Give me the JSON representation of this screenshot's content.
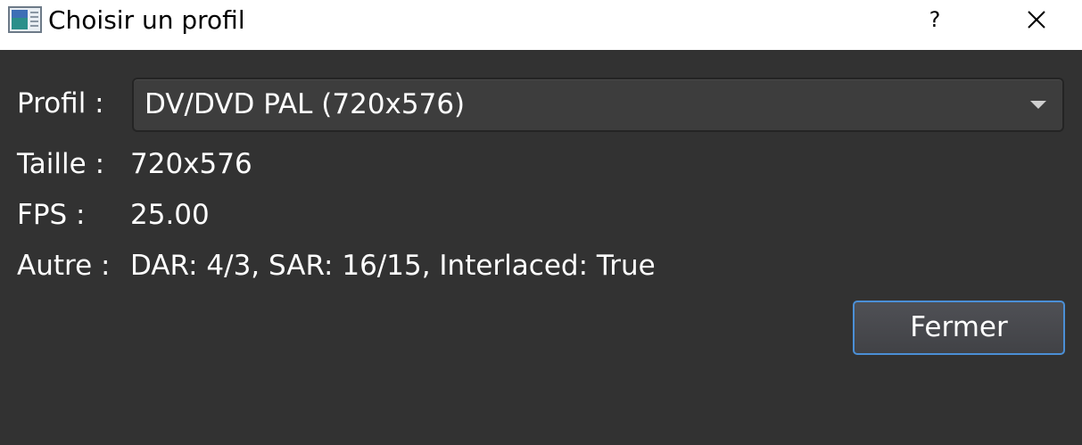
{
  "window": {
    "title": "Choisir un profil",
    "icon": "app-icon",
    "help_label": "?",
    "close_icon": "close-icon"
  },
  "form": {
    "profile_label": "Profil :",
    "profile_value": "DV/DVD PAL (720x576)",
    "size_label": "Taille :",
    "size_value": "720x576",
    "fps_label": "FPS :",
    "fps_value": "25.00",
    "other_label": "Autre :",
    "other_value": "DAR: 4/3, SAR: 16/15, Interlaced: True"
  },
  "buttons": {
    "close_label": "Fermer"
  },
  "colors": {
    "background": "#323232",
    "titlebar": "#ffffff",
    "focus_border": "#4b8fd6"
  }
}
